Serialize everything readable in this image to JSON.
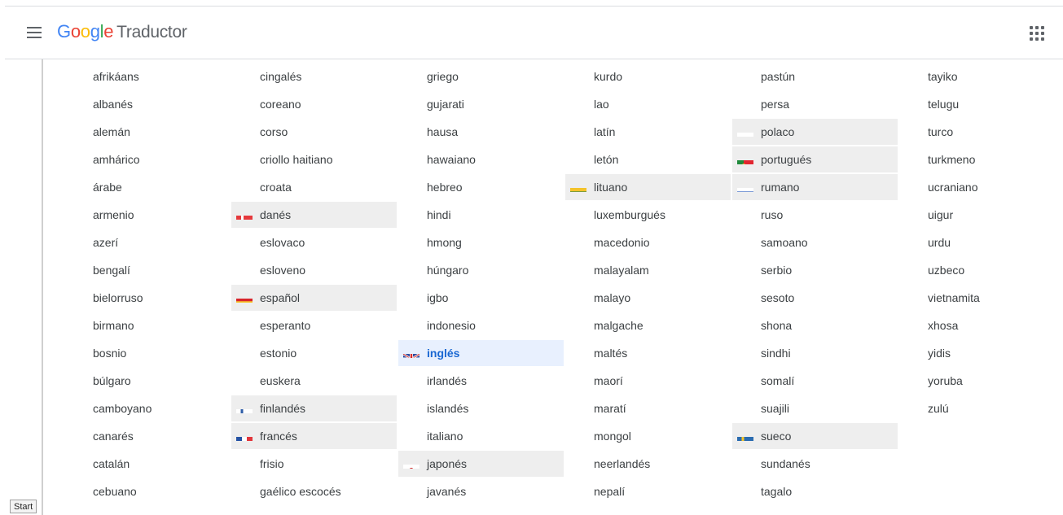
{
  "header": {
    "logo_letters": [
      "G",
      "o",
      "o",
      "g",
      "l",
      "e"
    ],
    "product": "Traductor",
    "menu_icon": "hamburger-menu-icon",
    "apps_icon": "apps-grid-icon"
  },
  "columns": [
    [
      {
        "label": "afrikáans"
      },
      {
        "label": "albanés"
      },
      {
        "label": "alemán"
      },
      {
        "label": "amhárico"
      },
      {
        "label": "árabe"
      },
      {
        "label": "armenio"
      },
      {
        "label": "azerí"
      },
      {
        "label": "bengalí"
      },
      {
        "label": "bielorruso"
      },
      {
        "label": "birmano"
      },
      {
        "label": "bosnio"
      },
      {
        "label": "búlgaro"
      },
      {
        "label": "camboyano"
      },
      {
        "label": "canarés"
      },
      {
        "label": "catalán"
      },
      {
        "label": "cebuano"
      }
    ],
    [
      {
        "label": "cingalés"
      },
      {
        "label": "coreano"
      },
      {
        "label": "corso"
      },
      {
        "label": "criollo haitiano"
      },
      {
        "label": "croata"
      },
      {
        "label": "danés",
        "flag": "denmark",
        "state": "recent"
      },
      {
        "label": "eslovaco"
      },
      {
        "label": "esloveno"
      },
      {
        "label": "español",
        "flag": "spain",
        "state": "recent"
      },
      {
        "label": "esperanto"
      },
      {
        "label": "estonio"
      },
      {
        "label": "euskera"
      },
      {
        "label": "finlandés",
        "flag": "finland",
        "state": "recent"
      },
      {
        "label": "francés",
        "flag": "france",
        "state": "recent"
      },
      {
        "label": "frisio"
      },
      {
        "label": "gaélico escocés"
      }
    ],
    [
      {
        "label": "griego"
      },
      {
        "label": "gujarati"
      },
      {
        "label": "hausa"
      },
      {
        "label": "hawaiano"
      },
      {
        "label": "hebreo"
      },
      {
        "label": "hindi"
      },
      {
        "label": "hmong"
      },
      {
        "label": "húngaro"
      },
      {
        "label": "igbo"
      },
      {
        "label": "indonesio"
      },
      {
        "label": "inglés",
        "flag": "uk",
        "state": "selected"
      },
      {
        "label": "irlandés"
      },
      {
        "label": "islandés"
      },
      {
        "label": "italiano"
      },
      {
        "label": "japonés",
        "flag": "japan",
        "state": "recent"
      },
      {
        "label": "javanés"
      }
    ],
    [
      {
        "label": "kurdo"
      },
      {
        "label": "lao"
      },
      {
        "label": "latín"
      },
      {
        "label": "letón"
      },
      {
        "label": "lituano",
        "flag": "lithuania",
        "state": "recent"
      },
      {
        "label": "luxemburgués"
      },
      {
        "label": "macedonio"
      },
      {
        "label": "malayalam"
      },
      {
        "label": "malayo"
      },
      {
        "label": "malgache"
      },
      {
        "label": "maltés"
      },
      {
        "label": "maorí"
      },
      {
        "label": "maratí"
      },
      {
        "label": "mongol"
      },
      {
        "label": "neerlandés"
      },
      {
        "label": "nepalí"
      }
    ],
    [
      {
        "label": "pastún"
      },
      {
        "label": "persa"
      },
      {
        "label": "polaco",
        "flag": "poland",
        "state": "recent"
      },
      {
        "label": "portugués",
        "flag": "portugal",
        "state": "recent"
      },
      {
        "label": "rumano",
        "flag": "russia",
        "state": "recent"
      },
      {
        "label": "ruso"
      },
      {
        "label": "samoano"
      },
      {
        "label": "serbio"
      },
      {
        "label": "sesoto"
      },
      {
        "label": "shona"
      },
      {
        "label": "sindhi"
      },
      {
        "label": "somalí"
      },
      {
        "label": "suajili"
      },
      {
        "label": "sueco",
        "flag": "sweden",
        "state": "recent"
      },
      {
        "label": "sundanés"
      },
      {
        "label": "tagalo"
      }
    ],
    [
      {
        "label": "tayiko"
      },
      {
        "label": "telugu"
      },
      {
        "label": "turco"
      },
      {
        "label": "turkmeno"
      },
      {
        "label": "ucraniano"
      },
      {
        "label": "uigur"
      },
      {
        "label": "urdu"
      },
      {
        "label": "uzbeco"
      },
      {
        "label": "vietnamita"
      },
      {
        "label": "xhosa"
      },
      {
        "label": "yidis"
      },
      {
        "label": "yoruba"
      },
      {
        "label": "zulú"
      }
    ]
  ],
  "taskbar": {
    "start_label": "Start"
  }
}
